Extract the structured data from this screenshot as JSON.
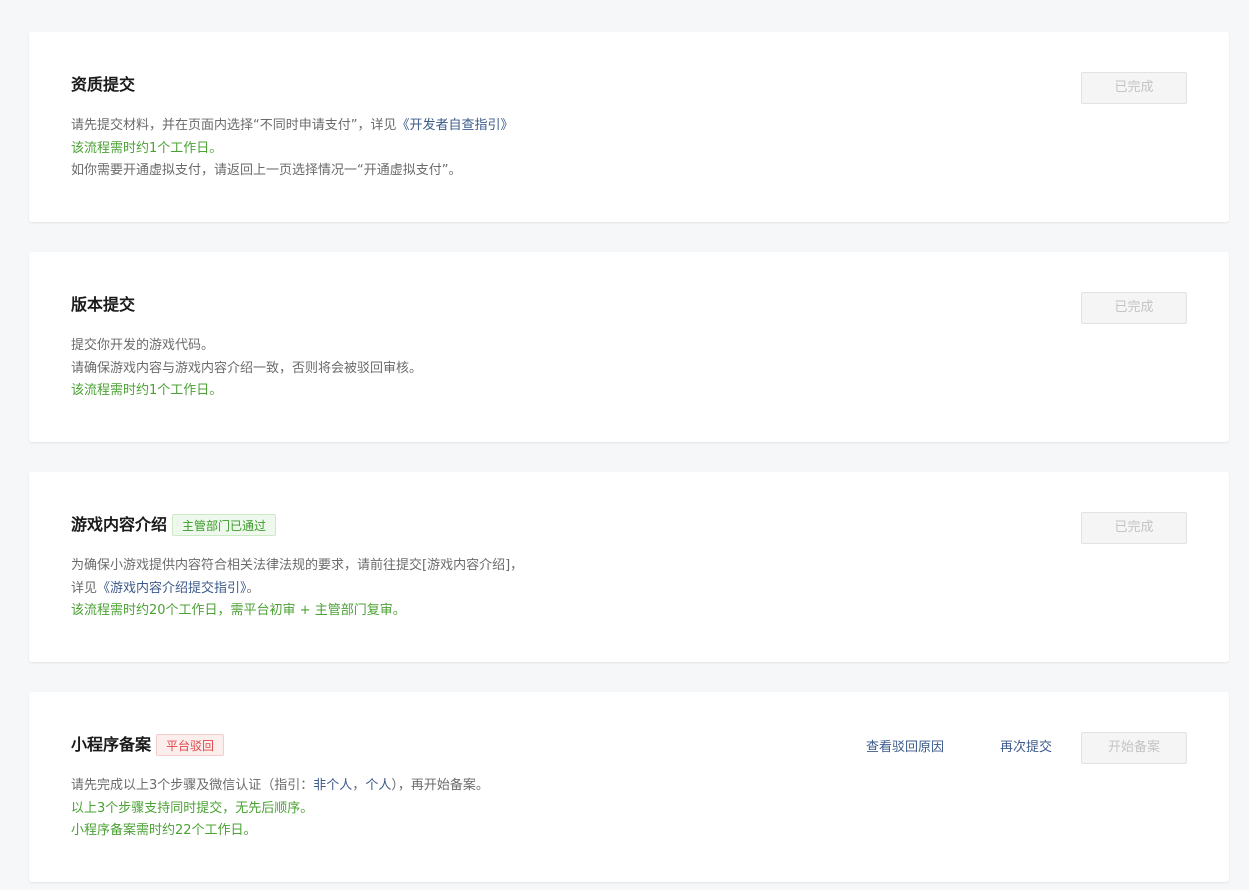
{
  "steps": [
    {
      "title": "资质提交",
      "tag": "",
      "lines": [
        {
          "parts": [
            {
              "text": "请先提交材料，并在页面内选择“不同时申请支付”，详见",
              "style": "normal"
            },
            {
              "text": "《开发者自查指引》",
              "style": "link"
            }
          ]
        },
        {
          "parts": [
            {
              "text": "该流程需时约1个工作日。",
              "style": "green"
            }
          ]
        },
        {
          "parts": [
            {
              "text": "如你需要开通虚拟支付，请返回上一页选择情况一“开通虚拟支付”。",
              "style": "normal"
            }
          ]
        }
      ],
      "button_label": "已完成"
    },
    {
      "title": "版本提交",
      "tag": "",
      "lines": [
        {
          "parts": [
            {
              "text": "提交你开发的游戏代码。",
              "style": "normal"
            }
          ]
        },
        {
          "parts": [
            {
              "text": "请确保游戏内容与游戏内容介绍一致，否则将会被驳回审核。",
              "style": "normal"
            }
          ]
        },
        {
          "parts": [
            {
              "text": "该流程需时约1个工作日。",
              "style": "green"
            }
          ]
        }
      ],
      "button_label": "已完成"
    },
    {
      "title": "游戏内容介绍",
      "tag": "主管部门已通过",
      "lines": [
        {
          "parts": [
            {
              "text": "为确保小游戏提供内容符合相关法律法规的要求，请前往提交[游戏内容介绍]，",
              "style": "normal"
            }
          ]
        },
        {
          "parts": [
            {
              "text": "详见",
              "style": "normal"
            },
            {
              "text": "《游戏内容介绍提交指引》",
              "style": "link"
            },
            {
              "text": "。",
              "style": "normal"
            }
          ]
        },
        {
          "parts": [
            {
              "text": "该流程需时约20个工作日，需平台初审 + 主管部门复审。",
              "style": "green"
            }
          ]
        }
      ],
      "button_label": "已完成"
    },
    {
      "title": "小程序备案",
      "tag": "平台驳回",
      "lines": [
        {
          "parts": [
            {
              "text": "请先完成以上3个步骤及微信认证（指引：",
              "style": "normal"
            },
            {
              "text": "非个人",
              "style": "link"
            },
            {
              "text": "，",
              "style": "normal"
            },
            {
              "text": "个人",
              "style": "link"
            },
            {
              "text": "），再开始备案。",
              "style": "normal"
            }
          ]
        },
        {
          "parts": [
            {
              "text": "以上3个步骤支持同时提交，无先后顺序。",
              "style": "green"
            }
          ]
        },
        {
          "parts": [
            {
              "text": "小程序备案需时约22个工作日。",
              "style": "green"
            }
          ]
        }
      ],
      "view_reason_label": "查看驳回原因",
      "resubmit_label": "再次提交",
      "button_label": "开始备案"
    }
  ],
  "colors": {
    "green_text": "#4ba135",
    "link_text": "#3c5a8a",
    "tag_green": "#3b9b2a",
    "tag_red": "#e24848"
  }
}
